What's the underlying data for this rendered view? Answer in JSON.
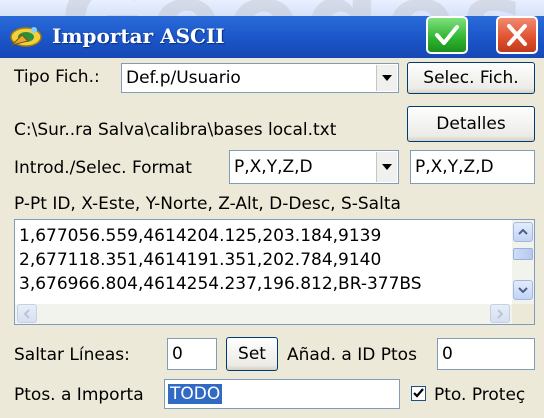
{
  "window": {
    "title": "Importar ASCII",
    "watermark": "Geodes",
    "ok_icon": "checkmark-icon",
    "close_icon": "close-x-icon"
  },
  "file_type": {
    "label": "Tipo Fich.:",
    "value": "Def.p/Usuario",
    "select_button": "Selec. Fich."
  },
  "path": {
    "text": "C:\\Sur..ra Salva\\calibra\\bases local.txt",
    "details_button": "Detalles"
  },
  "format": {
    "label": "Introd./Selec. Format",
    "combo_value": "P,X,Y,Z,D",
    "input_value": "P,X,Y,Z,D"
  },
  "legend": "P-Pt ID, X-Este, Y-Norte, Z-Alt, D-Desc, S-Salta",
  "preview_lines": [
    "1,677056.559,4614204.125,203.184,9139",
    "2,677118.351,4614191.351,202.784,9140",
    "3,676966.804,4614254.237,196.812,BR-377BS"
  ],
  "skip": {
    "label": "Saltar  Líneas:",
    "value": "0",
    "set_button": "Set",
    "add_label": "Añad. a ID Ptos",
    "add_value": "0"
  },
  "import": {
    "label": "Ptos. a Importa",
    "value": "TODO",
    "protect_label": "Pto. Proteç",
    "protect_checked": true
  },
  "colors": {
    "title_bar": "#1b55c8",
    "ok_button": "#2fb52f",
    "close_button": "#e0502e",
    "selection": "#316ac5"
  }
}
